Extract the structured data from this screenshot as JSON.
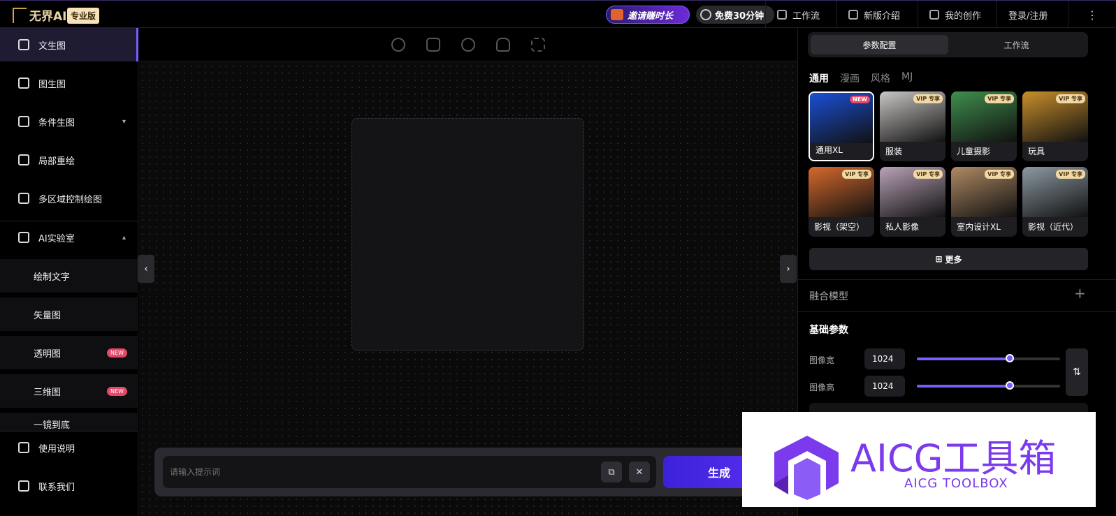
{
  "header": {
    "logo_text": "无界AI",
    "pro_badge": "专业版",
    "invite": "邀请赚时长",
    "free": "免费30分钟",
    "nav": [
      "工作流",
      "新版介绍",
      "我的创作",
      "登录/注册"
    ],
    "more_icon": "vertical-dots-icon"
  },
  "sidebar": {
    "items": [
      {
        "label": "文生图",
        "icon": "image-icon",
        "active": true
      },
      {
        "label": "图生图",
        "icon": "image-landscape-icon"
      },
      {
        "label": "条件生图",
        "icon": "bounding-box-icon"
      },
      {
        "label": "局部重绘",
        "icon": "brush-icon"
      },
      {
        "label": "多区域控制绘图",
        "icon": "regions-icon"
      },
      {
        "label": "AI实验室",
        "icon": "flask-icon"
      }
    ],
    "lab_items": [
      {
        "label": "绘制文字"
      },
      {
        "label": "矢量图"
      },
      {
        "label": "透明图",
        "badge": "NEW"
      },
      {
        "label": "三维图",
        "badge": "NEW"
      },
      {
        "label": "一镜到底"
      }
    ],
    "bottom": [
      {
        "label": "使用说明",
        "icon": "book-icon"
      },
      {
        "label": "联系我们",
        "icon": "headset-icon"
      }
    ]
  },
  "canvas": {
    "prompt_placeholder": "请输入提示词",
    "generate": "生成",
    "tools": [
      "rotate-icon",
      "crop-icon",
      "smile-icon",
      "hand-icon",
      "fullscreen-icon"
    ]
  },
  "right_panel": {
    "tabs": [
      "参数配置",
      "工作流"
    ],
    "categories": [
      "通用",
      "漫画",
      "风格",
      "MJ"
    ],
    "models": [
      {
        "label": "通用XL",
        "tag": "NEW",
        "color": "#1a4fd6"
      },
      {
        "label": "服装",
        "tag": "VIP 专享",
        "color": "#c9c6c4"
      },
      {
        "label": "儿童摄影",
        "tag": "VIP 专享",
        "color": "#3f8f4d"
      },
      {
        "label": "玩具",
        "tag": "VIP 专享",
        "color": "#c98f2a"
      },
      {
        "label": "影视（架空）",
        "tag": "VIP 专享",
        "color": "#d66a2c"
      },
      {
        "label": "私人影像",
        "tag": "VIP 专享",
        "color": "#b9a3b7"
      },
      {
        "label": "室内设计XL",
        "tag": "VIP 专享",
        "color": "#b08a64"
      },
      {
        "label": "影视（近代）",
        "tag": "VIP 专享",
        "color": "#8d9aa3"
      }
    ],
    "more": "更多",
    "fusion": "融合模型",
    "basic": "基础参数",
    "width_label": "图像宽",
    "width_value": "1024",
    "width_fraction": 0.65,
    "height_label": "图像高",
    "height_value": "1024",
    "height_fraction": 0.65
  },
  "watermark": {
    "title": "AICG工具箱",
    "subtitle": "AICG TOOLBOX"
  }
}
